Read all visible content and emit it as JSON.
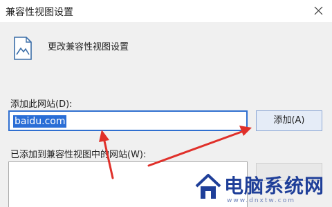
{
  "window": {
    "title": "兼容性视图设置",
    "close_icon": "close-icon"
  },
  "header": {
    "icon": "compat-view-page-icon",
    "text": "更改兼容性视图设置"
  },
  "add_site": {
    "label": "添加此网站(D):",
    "value": "baidu.com",
    "button_label": "添加(A)"
  },
  "added_sites": {
    "label": "已添加到兼容性视图中的网站(W):",
    "items": []
  },
  "colors": {
    "input_focus_border": "#2f6fd0",
    "selection": "#2a6ed6",
    "annotation_arrow": "#e0302a",
    "watermark": "#1f3f99"
  },
  "watermark": {
    "brand": "电脑系统网",
    "url": "www.dnxtw.com"
  }
}
